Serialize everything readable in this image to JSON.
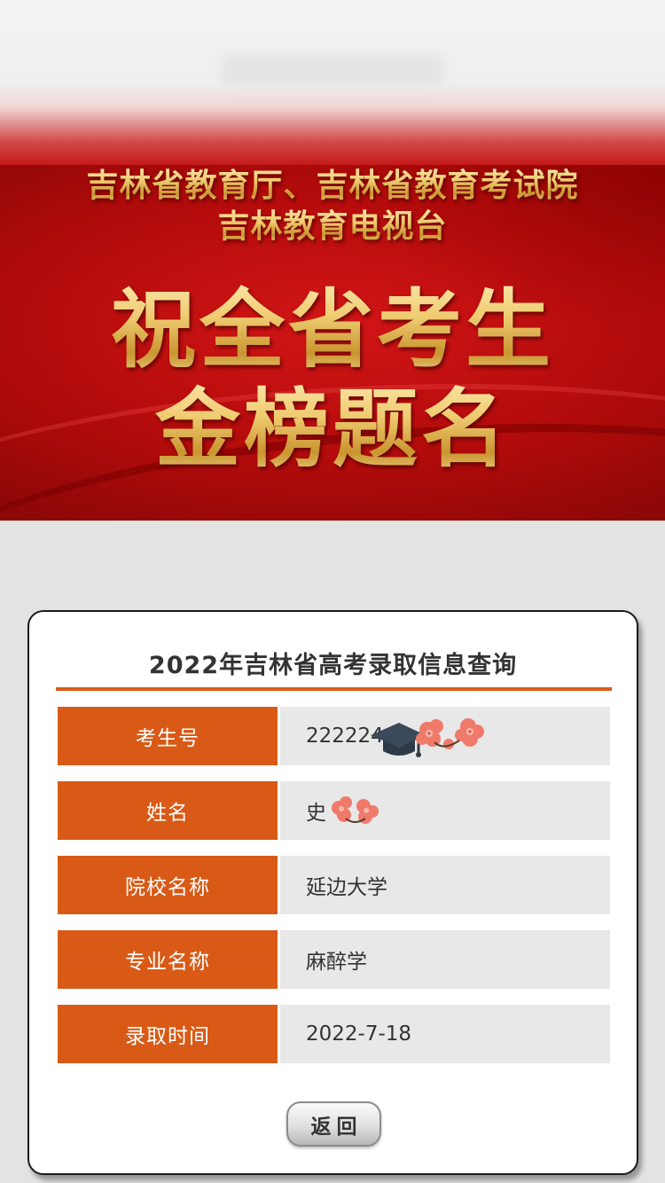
{
  "banner": {
    "org_line1": "吉林省教育厅、吉林省教育考试院",
    "org_line2": "吉林教育电视台",
    "slogan_line1": "祝全省考生",
    "slogan_line2": "金榜题名"
  },
  "query": {
    "title": "2022年吉林省高考录取信息查询",
    "rows": [
      {
        "label": "考生号",
        "value": "222224"
      },
      {
        "label": "姓名",
        "value": "史"
      },
      {
        "label": "院校名称",
        "value": "延边大学"
      },
      {
        "label": "专业名称",
        "value": "麻醉学"
      },
      {
        "label": "录取时间",
        "value": "2022-7-18"
      }
    ],
    "back_label": "返回"
  },
  "colors": {
    "accent": "#d85a16",
    "banner_red": "#c41a1a",
    "gold": "#f0cc72",
    "value_bg": "#e8e8e8"
  },
  "icons": {
    "redaction_stickers": [
      "graduation-cap-icon",
      "flower-icon"
    ]
  }
}
